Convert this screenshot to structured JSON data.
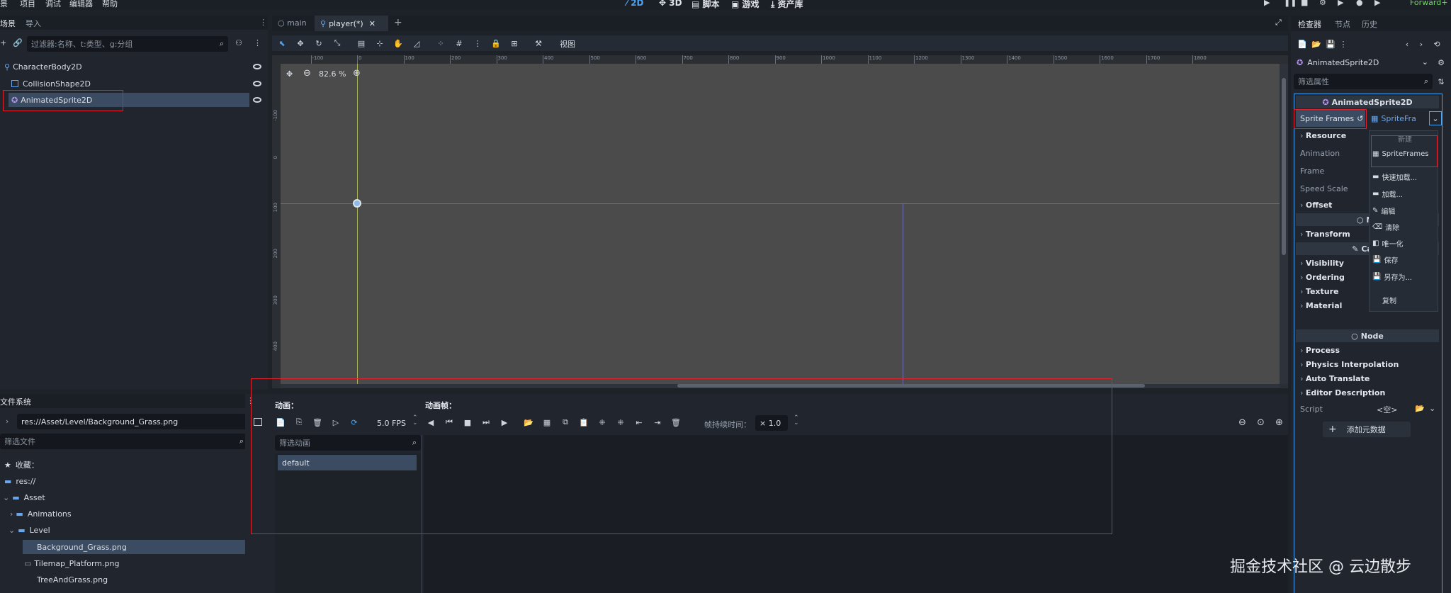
{
  "menu": [
    "景",
    "项目",
    "调试",
    "编辑器",
    "帮助"
  ],
  "modes": [
    "2D",
    "3D",
    "脚本",
    "游戏",
    "资产库"
  ],
  "renderer": "Forward+",
  "scene_dock": {
    "tabs": [
      "场景",
      "导入"
    ],
    "filter_placeholder": "过滤器:名称、t:类型、g:分组",
    "nodes": [
      "CharacterBody2D",
      "CollisionShape2D",
      "AnimatedSprite2D"
    ]
  },
  "editor_tabs": [
    "main",
    "player(*)"
  ],
  "viewport": {
    "view_label": "视图",
    "zoom": "82.6 %",
    "ruler_h": [
      "-100",
      "0",
      "100",
      "200",
      "300",
      "400",
      "500",
      "600",
      "700",
      "800",
      "900",
      "1000",
      "1100",
      "1200",
      "1300",
      "1400",
      "1500",
      "1600",
      "1700",
      "1800"
    ],
    "ruler_v": [
      "-100",
      "0",
      "100",
      "200",
      "300",
      "400"
    ]
  },
  "filesystem": {
    "title": "文件系统",
    "path": "res://Asset/Level/Background_Grass.png",
    "filter_placeholder": "筛选文件",
    "items": [
      "收藏：",
      "res://",
      "Asset",
      "Animations",
      "Level",
      "Background_Grass.png",
      "Tilemap_Platform.png",
      "TreeAndGrass.png"
    ]
  },
  "animation_panel": {
    "animations_label": "动画：",
    "frames_label": "动画帧：",
    "fps": "5.0 FPS",
    "frame_duration_label": "帧持续时间：",
    "frame_duration": "× 1.0",
    "filter_placeholder": "筛选动画",
    "anim_list": [
      "default"
    ]
  },
  "inspector": {
    "tabs": [
      "检查器",
      "节点",
      "历史"
    ],
    "node_type": "AnimatedSprite2D",
    "filter_placeholder": "筛选属性",
    "class_header": "AnimatedSprite2D",
    "sprite_frames_label": "Sprite Frames",
    "sprite_frames_value": "SpriteFra",
    "resource": "Resource",
    "props": [
      "Animation",
      "Frame",
      "Speed Scale"
    ],
    "offset": "Offset",
    "node2d_header": "No",
    "transform": "Transform",
    "canvas_header": "Canv",
    "canvas_sections": [
      "Visibility",
      "Ordering",
      "Texture",
      "Material"
    ],
    "node_header": "Node",
    "node_sections": [
      "Process",
      "Physics Interpolation",
      "Auto Translate",
      "Editor Description"
    ],
    "script_label": "Script",
    "script_value": "<空>",
    "add_metadata": "添加元数据"
  },
  "popup": {
    "new_label": "新建",
    "items": [
      "SpriteFrames",
      "快速加载...",
      "加载...",
      "编辑",
      "清除",
      "唯一化",
      "保存",
      "另存为...",
      "复制"
    ]
  },
  "watermark": "掘金技术社区 @ 云边散步",
  "colors": {
    "accent": "#4aa3f0",
    "highlight_red": "#e0202a",
    "selection": "#3b4b62",
    "viewport_bg": "#4b4b4b"
  }
}
